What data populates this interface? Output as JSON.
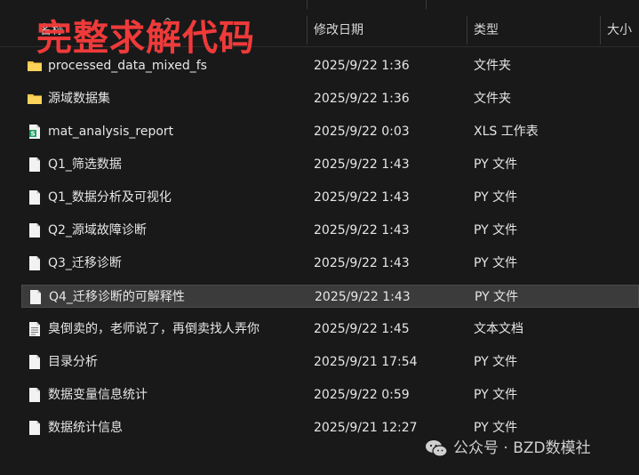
{
  "overlay_title": "完整求解代码",
  "columns": {
    "name": "名称",
    "date": "修改日期",
    "type": "类型",
    "size": "大小"
  },
  "colors": {
    "background": "#191919",
    "selected_row": "#3b3b3b",
    "overlay_red": "#ef3a3a",
    "folder_yellow": "#f5c446",
    "excel_green": "#21a366"
  },
  "files": [
    {
      "name": "processed_data_mixed_fs",
      "date": "2025/9/22 1:36",
      "type": "文件夹",
      "icon": "folder-icon"
    },
    {
      "name": "源域数据集",
      "date": "2025/9/22 1:36",
      "type": "文件夹",
      "icon": "folder-icon"
    },
    {
      "name": "mat_analysis_report",
      "date": "2025/9/22 0:03",
      "type": "XLS 工作表",
      "icon": "spreadsheet-icon"
    },
    {
      "name": "Q1_筛选数据",
      "date": "2025/9/22 1:43",
      "type": "PY 文件",
      "icon": "file-icon"
    },
    {
      "name": "Q1_数据分析及可视化",
      "date": "2025/9/22 1:43",
      "type": "PY 文件",
      "icon": "file-icon"
    },
    {
      "name": "Q2_源域故障诊断",
      "date": "2025/9/22 1:43",
      "type": "PY 文件",
      "icon": "file-icon"
    },
    {
      "name": "Q3_迁移诊断",
      "date": "2025/9/22 1:43",
      "type": "PY 文件",
      "icon": "file-icon"
    },
    {
      "name": "Q4_迁移诊断的可解释性",
      "date": "2025/9/22 1:43",
      "type": "PY 文件",
      "icon": "file-icon",
      "selected": true
    },
    {
      "name": "臭倒卖的，老师说了，再倒卖找人弄你",
      "date": "2025/9/22 1:45",
      "type": "文本文档",
      "icon": "text-document-icon"
    },
    {
      "name": "目录分析",
      "date": "2025/9/21 17:54",
      "type": "PY 文件",
      "icon": "file-icon"
    },
    {
      "name": "数据变量信息统计",
      "date": "2025/9/22 0:59",
      "type": "PY 文件",
      "icon": "file-icon"
    },
    {
      "name": "数据统计信息",
      "date": "2025/9/21 12:27",
      "type": "PY 文件",
      "icon": "file-icon"
    }
  ],
  "watermark": {
    "text": "公众号 · BZD数模社",
    "icon": "wechat-icon"
  }
}
